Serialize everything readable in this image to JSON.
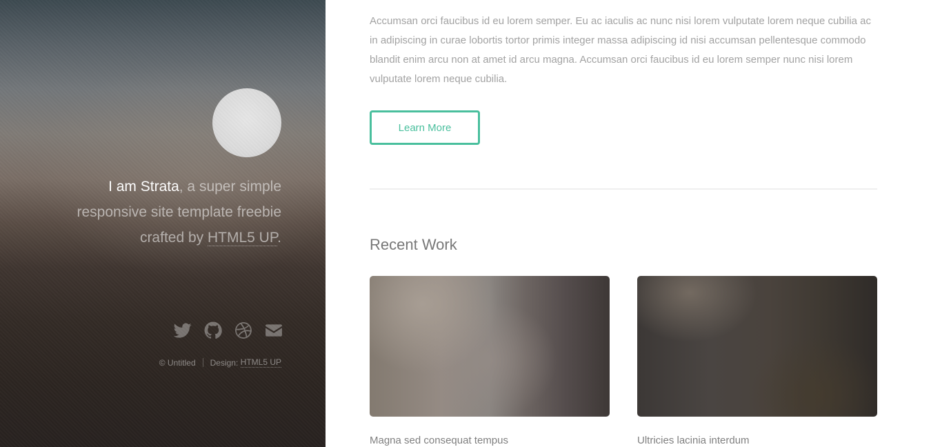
{
  "header": {
    "intro": {
      "name": "I am Strata",
      "text_before_link": ", a super simple responsive site template freebie crafted by ",
      "link": "HTML5 UP",
      "text_after_link": "."
    },
    "social": [
      {
        "icon": "twitter-icon"
      },
      {
        "icon": "github-icon"
      },
      {
        "icon": "dribbble-icon"
      },
      {
        "icon": "envelope-icon"
      }
    ],
    "copyright": {
      "text": "© Untitled",
      "design_label": "Design: ",
      "design_link": "HTML5 UP"
    }
  },
  "main": {
    "body": "Accumsan orci faucibus id eu lorem semper. Eu ac iaculis ac nunc nisi lorem vulputate lorem neque cubilia ac in adipiscing in curae lobortis tortor primis integer massa adipiscing id nisi accumsan pellentesque commodo blandit enim arcu non at amet id arcu magna. Accumsan orci faucibus id eu lorem semper nunc nisi lorem vulputate lorem neque cubilia.",
    "button_label": "Learn More",
    "section_title": "Recent Work",
    "works": [
      {
        "title": "Magna sed consequat tempus"
      },
      {
        "title": "Ultricies lacinia interdum"
      }
    ]
  },
  "colors": {
    "accent": "#49bf9d",
    "body_text": "#a2a2a2",
    "heading": "#777777"
  }
}
